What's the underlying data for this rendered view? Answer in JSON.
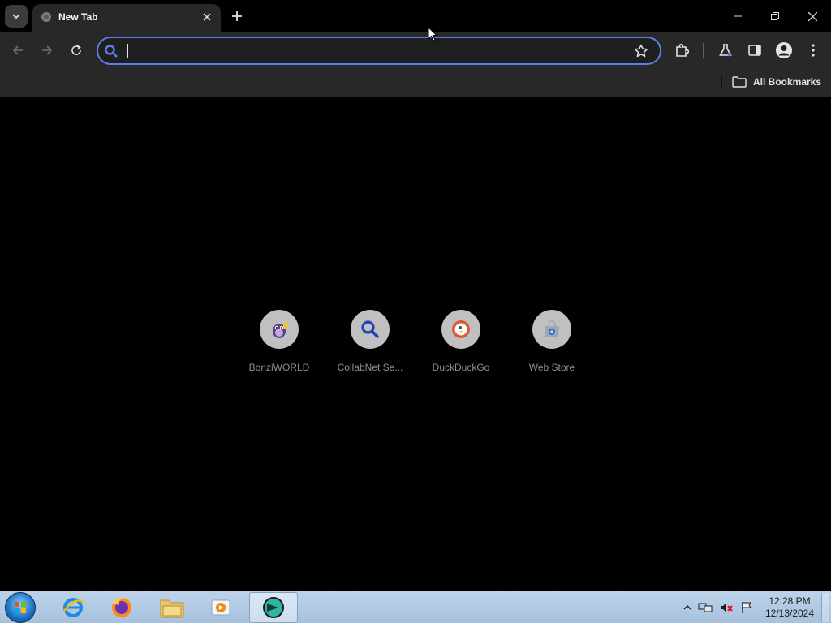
{
  "browser": {
    "tab": {
      "title": "New Tab"
    },
    "omnibox": {
      "value": "",
      "placeholder": ""
    },
    "bookmarks_bar": {
      "all_bookmarks_label": "All Bookmarks"
    },
    "accent_color": "#5b7fe8"
  },
  "shortcuts": [
    {
      "label": "BonziWORLD",
      "icon": "bonzi-icon"
    },
    {
      "label": "CollabNet Se...",
      "icon": "search-icon"
    },
    {
      "label": "DuckDuckGo",
      "icon": "duckduckgo-icon"
    },
    {
      "label": "Web Store",
      "icon": "webstore-icon"
    }
  ],
  "taskbar": {
    "apps": [
      "start-button",
      "internet-explorer-icon",
      "firefox-icon",
      "file-explorer-icon",
      "media-player-icon",
      "browser-icon"
    ],
    "clock": {
      "time": "12:28 PM",
      "date": "12/13/2024"
    }
  }
}
